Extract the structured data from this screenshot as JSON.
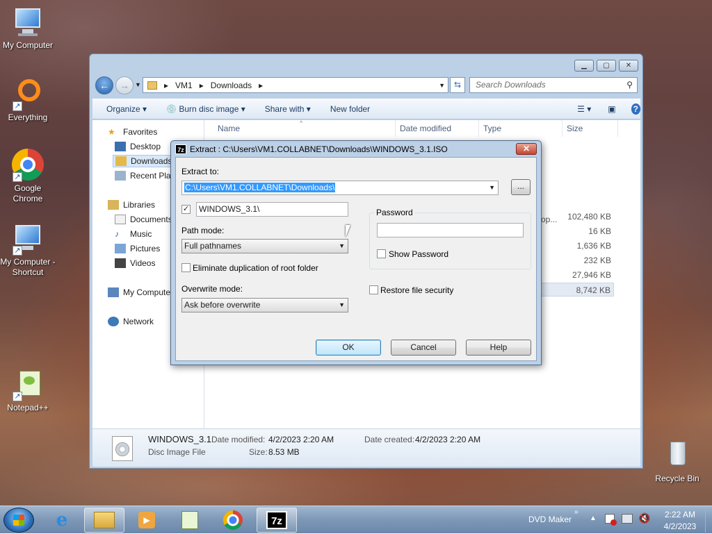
{
  "desktop": {
    "icons": [
      {
        "label": "My Computer"
      },
      {
        "label": "Everything"
      },
      {
        "label": "Google Chrome"
      },
      {
        "label": "My Computer - Shortcut"
      },
      {
        "label": "Notepad++"
      },
      {
        "label": "Recycle Bin"
      }
    ]
  },
  "explorer": {
    "breadcrumb": [
      "VM1",
      "Downloads"
    ],
    "search_placeholder": "Search Downloads",
    "toolbar": {
      "organize": "Organize",
      "burn": "Burn disc image",
      "share": "Share with",
      "new_folder": "New folder"
    },
    "nav": {
      "favorites": "Favorites",
      "desktop": "Desktop",
      "downloads": "Downloads",
      "recent": "Recent Places",
      "libraries": "Libraries",
      "documents": "Documents",
      "music": "Music",
      "pictures": "Pictures",
      "videos": "Videos",
      "computer": "My Computer",
      "network": "Network"
    },
    "columns": {
      "name": "Name",
      "date": "Date modified",
      "type": "Type",
      "size": "Size"
    },
    "sizes": [
      "102,480 KB",
      "16 KB",
      "1,636 KB",
      "232 KB",
      "27,946 KB",
      "8,742 KB"
    ],
    "partial_type": "op...",
    "details": {
      "name": "WINDOWS_3.1",
      "type": "Disc Image File",
      "date_modified_label": "Date modified:",
      "date_modified": "4/2/2023 2:20 AM",
      "date_created_label": "Date created:",
      "date_created": "4/2/2023 2:20 AM",
      "size_label": "Size:",
      "size": "8.53 MB"
    }
  },
  "dialog": {
    "app_icon": "7z",
    "title": "Extract : C:\\Users\\VM1.COLLABNET\\Downloads\\WINDOWS_3.1.ISO",
    "extract_to_label": "Extract to:",
    "extract_to_value": "C:\\Users\\VM1.COLLABNET\\Downloads\\",
    "browse": "...",
    "subfolder_value": "WINDOWS_3.1\\",
    "subfolder_checked": true,
    "path_mode_label": "Path mode:",
    "path_mode_value": "Full pathnames",
    "eliminate_label": "Eliminate duplication of root folder",
    "overwrite_label": "Overwrite mode:",
    "overwrite_value": "Ask before overwrite",
    "password_label": "Password",
    "show_password_label": "Show Password",
    "restore_security_label": "Restore file security",
    "ok": "OK",
    "cancel": "Cancel",
    "help": "Help"
  },
  "taskbar": {
    "dvd_maker": "DVD Maker",
    "time": "2:22 AM",
    "date": "4/2/2023",
    "seven_zip": "7z"
  }
}
